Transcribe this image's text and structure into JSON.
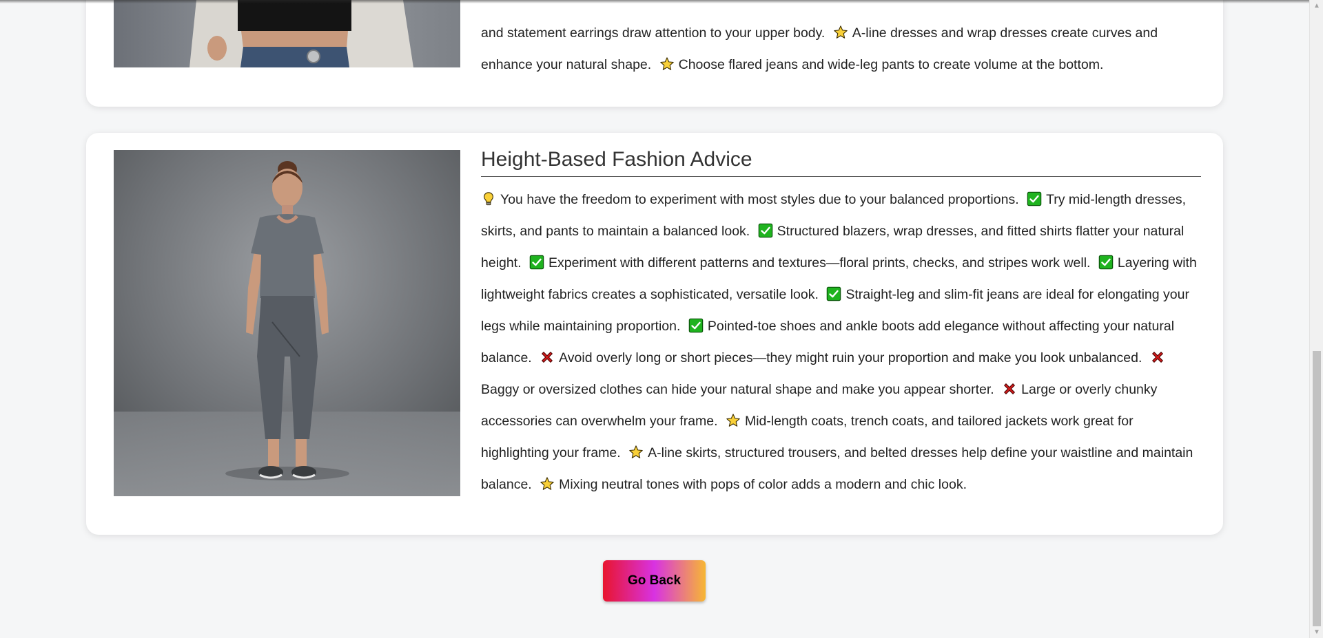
{
  "top_card": {
    "lines_text": [
      "and statement earrings draw attention to your upper body.",
      "A-line dresses and wrap dresses create curves and enhance your natural shape.",
      "Choose flared jeans and wide-leg pants to create volume at the bottom."
    ]
  },
  "height_section": {
    "title": "Height-Based Fashion Advice",
    "items": [
      {
        "icon": "lightbulb-icon",
        "text": "You have the freedom to experiment with most styles due to your balanced proportions."
      },
      {
        "icon": "check-icon",
        "text": "Try mid-length dresses, skirts, and pants to maintain a balanced look."
      },
      {
        "icon": "check-icon",
        "text": "Structured blazers, wrap dresses, and fitted shirts flatter your natural height."
      },
      {
        "icon": "check-icon",
        "text": "Experiment with different patterns and textures—floral prints, checks, and stripes work well."
      },
      {
        "icon": "check-icon",
        "text": "Layering with lightweight fabrics creates a sophisticated, versatile look."
      },
      {
        "icon": "check-icon",
        "text": "Straight-leg and slim-fit jeans are ideal for elongating your legs while maintaining proportion."
      },
      {
        "icon": "check-icon",
        "text": "Pointed-toe shoes and ankle boots add elegance without affecting your natural balance."
      },
      {
        "icon": "cross-icon",
        "text": "Avoid overly long or short pieces—they might ruin your proportion and make you look unbalanced."
      },
      {
        "icon": "cross-icon",
        "text": "Baggy or oversized clothes can hide your natural shape and make you appear shorter."
      },
      {
        "icon": "cross-icon",
        "text": "Large or overly chunky accessories can overwhelm your frame."
      },
      {
        "icon": "star-icon",
        "text": "Mid-length coats, trench coats, and tailored jackets work great for highlighting your frame."
      },
      {
        "icon": "star-icon",
        "text": "A-line skirts, structured trousers, and belted dresses help define your waistline and maintain balance."
      },
      {
        "icon": "star-icon",
        "text": "Mixing neutral tones with pops of color adds a modern and chic look."
      }
    ]
  },
  "actions": {
    "go_back_label": "Go Back"
  },
  "colors": {
    "button_gradient_start": "#e8152e",
    "button_gradient_mid": "#d832e2",
    "button_gradient_end": "#f7b733",
    "check_green": "#1fb31f",
    "cross_red": "#d01a1a",
    "star_yellow": "#f9d038"
  }
}
